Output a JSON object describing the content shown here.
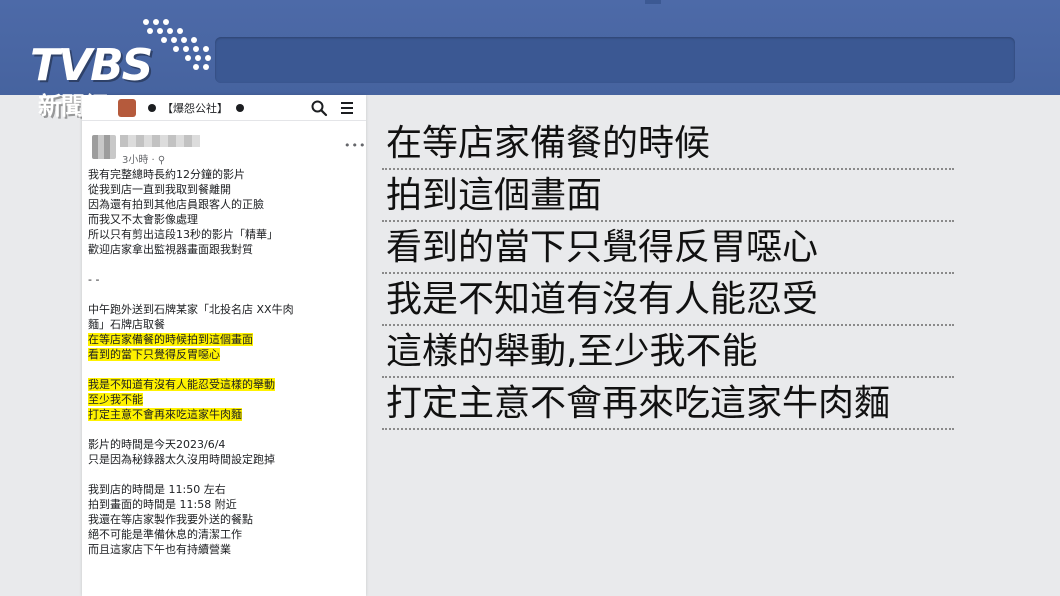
{
  "brand": {
    "logo_main": "TVBS",
    "logo_sub": "新聞網"
  },
  "phone": {
    "group_name": "【爆怨公社】",
    "poster_meta": "3小時 · ⚲",
    "more_label": "•••",
    "icons": [
      "search-icon",
      "menu-icon",
      "more-options-icon"
    ],
    "post_lines": [
      {
        "text": "我有完整總時長約12分鐘的影片",
        "highlight": false
      },
      {
        "text": "從我到店一直到我取到餐離開",
        "highlight": false
      },
      {
        "text": "因為還有拍到其他店員跟客人的正臉",
        "highlight": false
      },
      {
        "text": "而我又不太會影像處理",
        "highlight": false
      },
      {
        "text": "所以只有剪出這段13秒的影片「精華」",
        "highlight": false
      },
      {
        "text": "歡迎店家拿出監視器畫面跟我對質",
        "highlight": false
      },
      {
        "text": "",
        "highlight": false
      },
      {
        "text": "- -",
        "highlight": false
      },
      {
        "text": "",
        "highlight": false
      },
      {
        "text": "中午跑外送到石牌某家「北投名店 XX牛肉",
        "highlight": false
      },
      {
        "text": "麵」石牌店取餐",
        "highlight": false
      },
      {
        "text": "在等店家備餐的時候拍到這個畫面",
        "highlight": true
      },
      {
        "text": "看到的當下只覺得反胃噁心",
        "highlight": true
      },
      {
        "text": "",
        "highlight": false
      },
      {
        "text": "我是不知道有沒有人能忍受這樣的舉動",
        "highlight": true
      },
      {
        "text": "至少我不能",
        "highlight": true
      },
      {
        "text": "打定主意不會再來吃這家牛肉麵",
        "highlight": true
      },
      {
        "text": "",
        "highlight": false
      },
      {
        "text": "影片的時間是今天2023/6/4",
        "highlight": false
      },
      {
        "text": "只是因為秘錄器太久沒用時間設定跑掉",
        "highlight": false
      },
      {
        "text": "",
        "highlight": false
      },
      {
        "text": "我到店的時間是 11:50 左右",
        "highlight": false
      },
      {
        "text": "拍到畫面的時間是 11:58 附近",
        "highlight": false
      },
      {
        "text": "我還在等店家製作我要外送的餐點",
        "highlight": false
      },
      {
        "text": "絕不可能是準備休息的清潔工作",
        "highlight": false
      },
      {
        "text": "而且這家店下午也有持續營業",
        "highlight": false
      }
    ]
  },
  "quotes": [
    "在等店家備餐的時候",
    "拍到這個畫面",
    "看到的當下只覺得反胃噁心",
    "我是不知道有沒有人能忍受",
    "這樣的舉動,至少我不能",
    "打定主意不會再來吃這家牛肉麵"
  ],
  "colors": {
    "top_band": "#4d6aa8",
    "top_inner_bar": "#3b5893",
    "background": "#e9eaec",
    "highlight": "#fff200"
  }
}
